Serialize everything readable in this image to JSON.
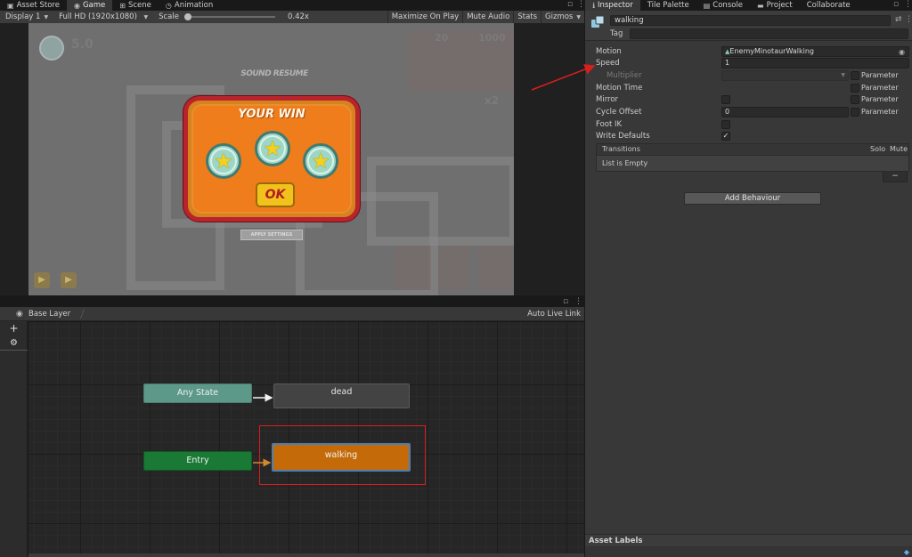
{
  "game_tabs": [
    {
      "label": "Asset Store",
      "icon": "store-icon"
    },
    {
      "label": "Game",
      "icon": "game-controller-icon"
    },
    {
      "label": "Scene",
      "icon": "scene-grid-icon"
    },
    {
      "label": "Animation",
      "icon": "animation-clock-icon"
    }
  ],
  "inspector_tabs": [
    {
      "label": "Inspector",
      "icon": "info-icon"
    },
    {
      "label": "Tile Palette",
      "icon": ""
    },
    {
      "label": "Console",
      "icon": "console-icon"
    },
    {
      "label": "Project",
      "icon": "folder-icon"
    },
    {
      "label": "Collaborate",
      "icon": ""
    }
  ],
  "game_toolbar": {
    "display": "Display 1",
    "resolution": "Full HD (1920x1080)",
    "scale_label": "Scale",
    "scale_value": "0.42x",
    "maximize": "Maximize On Play",
    "mute": "Mute Audio",
    "stats": "Stats",
    "gizmos": "Gizmos"
  },
  "game_view": {
    "sound_title": "SOUND RESUME",
    "win_title": "YOUR WIN",
    "ok_label": "OK",
    "apply_label": "APPLY SETTINGS",
    "hud_left": "5.0",
    "hud_coins": "20",
    "hud_score": "1000",
    "hud_multiplier": "x2"
  },
  "inspector": {
    "state_name": "walking",
    "tag_label": "Tag",
    "motion_label": "Motion",
    "motion_value": "EnemyMinotaurWalking",
    "speed_label": "Speed",
    "speed_value": "1",
    "multiplier_label": "Multiplier",
    "motion_time_label": "Motion Time",
    "mirror_label": "Mirror",
    "cycle_offset_label": "Cycle Offset",
    "cycle_offset_value": "0",
    "foot_ik_label": "Foot IK",
    "write_defaults_label": "Write Defaults",
    "write_defaults_checked": true,
    "parameter_label": "Parameter",
    "transitions_label": "Transitions",
    "solo_label": "Solo",
    "mute_label": "Mute",
    "list_empty": "List is Empty",
    "minus_label": "−",
    "add_behaviour": "Add Behaviour",
    "asset_labels": "Asset Labels"
  },
  "animator": {
    "layer": "Base Layer",
    "auto_live_link": "Auto Live Link",
    "nodes": {
      "any_state": "Any State",
      "dead": "dead",
      "entry": "Entry",
      "walking": "walking"
    }
  },
  "colors": {
    "accent_orange": "#c46a08",
    "any_state": "#5d9988",
    "entry": "#1a7a35",
    "annotation_red": "#d91e1e"
  }
}
